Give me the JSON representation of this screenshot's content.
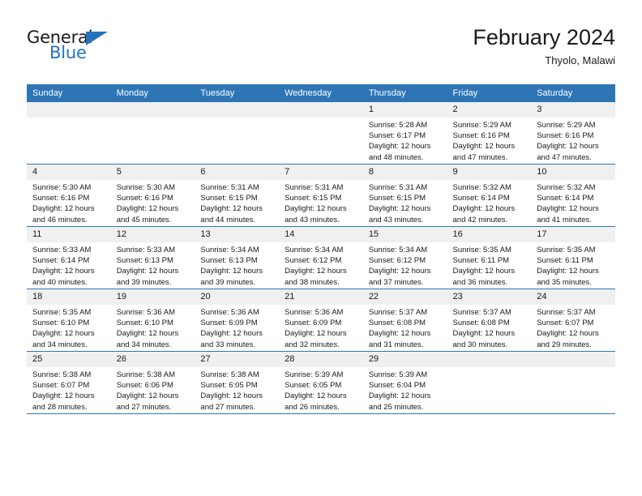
{
  "brand": {
    "name_part1": "General",
    "name_part2": "Blue",
    "triangle_icon": "triangle-icon",
    "accent_color": "#2573ba"
  },
  "header": {
    "title": "February 2024",
    "subtitle": "Thyolo, Malawi"
  },
  "theme": {
    "header_blue": "#2e75b6",
    "daynum_gray": "#f0f0f0",
    "text_color": "#1a1a1a"
  },
  "weekday_headers": [
    "Sunday",
    "Monday",
    "Tuesday",
    "Wednesday",
    "Thursday",
    "Friday",
    "Saturday"
  ],
  "weeks": [
    [
      {
        "day": "",
        "lines": []
      },
      {
        "day": "",
        "lines": []
      },
      {
        "day": "",
        "lines": []
      },
      {
        "day": "",
        "lines": []
      },
      {
        "day": "1",
        "lines": [
          "Sunrise: 5:28 AM",
          "Sunset: 6:17 PM",
          "Daylight: 12 hours",
          "and 48 minutes."
        ]
      },
      {
        "day": "2",
        "lines": [
          "Sunrise: 5:29 AM",
          "Sunset: 6:16 PM",
          "Daylight: 12 hours",
          "and 47 minutes."
        ]
      },
      {
        "day": "3",
        "lines": [
          "Sunrise: 5:29 AM",
          "Sunset: 6:16 PM",
          "Daylight: 12 hours",
          "and 47 minutes."
        ]
      }
    ],
    [
      {
        "day": "4",
        "lines": [
          "Sunrise: 5:30 AM",
          "Sunset: 6:16 PM",
          "Daylight: 12 hours",
          "and 46 minutes."
        ]
      },
      {
        "day": "5",
        "lines": [
          "Sunrise: 5:30 AM",
          "Sunset: 6:16 PM",
          "Daylight: 12 hours",
          "and 45 minutes."
        ]
      },
      {
        "day": "6",
        "lines": [
          "Sunrise: 5:31 AM",
          "Sunset: 6:15 PM",
          "Daylight: 12 hours",
          "and 44 minutes."
        ]
      },
      {
        "day": "7",
        "lines": [
          "Sunrise: 5:31 AM",
          "Sunset: 6:15 PM",
          "Daylight: 12 hours",
          "and 43 minutes."
        ]
      },
      {
        "day": "8",
        "lines": [
          "Sunrise: 5:31 AM",
          "Sunset: 6:15 PM",
          "Daylight: 12 hours",
          "and 43 minutes."
        ]
      },
      {
        "day": "9",
        "lines": [
          "Sunrise: 5:32 AM",
          "Sunset: 6:14 PM",
          "Daylight: 12 hours",
          "and 42 minutes."
        ]
      },
      {
        "day": "10",
        "lines": [
          "Sunrise: 5:32 AM",
          "Sunset: 6:14 PM",
          "Daylight: 12 hours",
          "and 41 minutes."
        ]
      }
    ],
    [
      {
        "day": "11",
        "lines": [
          "Sunrise: 5:33 AM",
          "Sunset: 6:14 PM",
          "Daylight: 12 hours",
          "and 40 minutes."
        ]
      },
      {
        "day": "12",
        "lines": [
          "Sunrise: 5:33 AM",
          "Sunset: 6:13 PM",
          "Daylight: 12 hours",
          "and 39 minutes."
        ]
      },
      {
        "day": "13",
        "lines": [
          "Sunrise: 5:34 AM",
          "Sunset: 6:13 PM",
          "Daylight: 12 hours",
          "and 39 minutes."
        ]
      },
      {
        "day": "14",
        "lines": [
          "Sunrise: 5:34 AM",
          "Sunset: 6:12 PM",
          "Daylight: 12 hours",
          "and 38 minutes."
        ]
      },
      {
        "day": "15",
        "lines": [
          "Sunrise: 5:34 AM",
          "Sunset: 6:12 PM",
          "Daylight: 12 hours",
          "and 37 minutes."
        ]
      },
      {
        "day": "16",
        "lines": [
          "Sunrise: 5:35 AM",
          "Sunset: 6:11 PM",
          "Daylight: 12 hours",
          "and 36 minutes."
        ]
      },
      {
        "day": "17",
        "lines": [
          "Sunrise: 5:35 AM",
          "Sunset: 6:11 PM",
          "Daylight: 12 hours",
          "and 35 minutes."
        ]
      }
    ],
    [
      {
        "day": "18",
        "lines": [
          "Sunrise: 5:35 AM",
          "Sunset: 6:10 PM",
          "Daylight: 12 hours",
          "and 34 minutes."
        ]
      },
      {
        "day": "19",
        "lines": [
          "Sunrise: 5:36 AM",
          "Sunset: 6:10 PM",
          "Daylight: 12 hours",
          "and 34 minutes."
        ]
      },
      {
        "day": "20",
        "lines": [
          "Sunrise: 5:36 AM",
          "Sunset: 6:09 PM",
          "Daylight: 12 hours",
          "and 33 minutes."
        ]
      },
      {
        "day": "21",
        "lines": [
          "Sunrise: 5:36 AM",
          "Sunset: 6:09 PM",
          "Daylight: 12 hours",
          "and 32 minutes."
        ]
      },
      {
        "day": "22",
        "lines": [
          "Sunrise: 5:37 AM",
          "Sunset: 6:08 PM",
          "Daylight: 12 hours",
          "and 31 minutes."
        ]
      },
      {
        "day": "23",
        "lines": [
          "Sunrise: 5:37 AM",
          "Sunset: 6:08 PM",
          "Daylight: 12 hours",
          "and 30 minutes."
        ]
      },
      {
        "day": "24",
        "lines": [
          "Sunrise: 5:37 AM",
          "Sunset: 6:07 PM",
          "Daylight: 12 hours",
          "and 29 minutes."
        ]
      }
    ],
    [
      {
        "day": "25",
        "lines": [
          "Sunrise: 5:38 AM",
          "Sunset: 6:07 PM",
          "Daylight: 12 hours",
          "and 28 minutes."
        ]
      },
      {
        "day": "26",
        "lines": [
          "Sunrise: 5:38 AM",
          "Sunset: 6:06 PM",
          "Daylight: 12 hours",
          "and 27 minutes."
        ]
      },
      {
        "day": "27",
        "lines": [
          "Sunrise: 5:38 AM",
          "Sunset: 6:05 PM",
          "Daylight: 12 hours",
          "and 27 minutes."
        ]
      },
      {
        "day": "28",
        "lines": [
          "Sunrise: 5:39 AM",
          "Sunset: 6:05 PM",
          "Daylight: 12 hours",
          "and 26 minutes."
        ]
      },
      {
        "day": "29",
        "lines": [
          "Sunrise: 5:39 AM",
          "Sunset: 6:04 PM",
          "Daylight: 12 hours",
          "and 25 minutes."
        ]
      },
      {
        "day": "",
        "lines": []
      },
      {
        "day": "",
        "lines": []
      }
    ]
  ]
}
